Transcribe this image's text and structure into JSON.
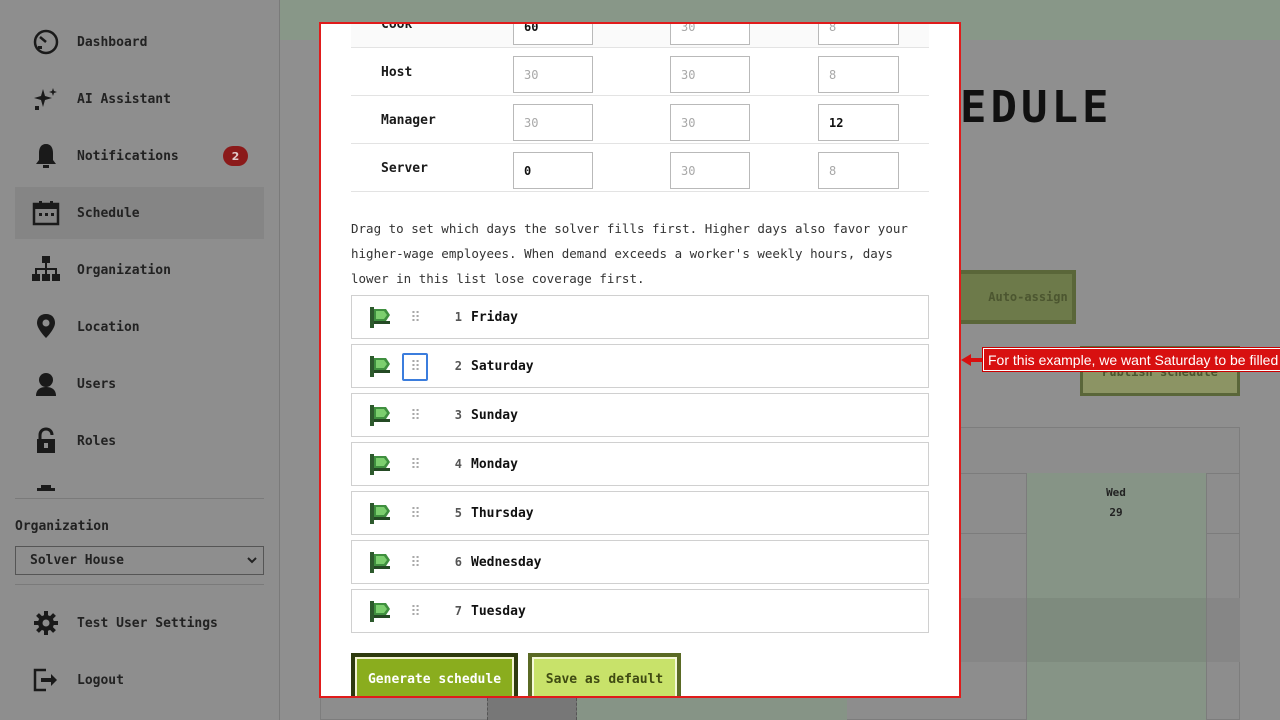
{
  "sidebar": {
    "items": [
      {
        "label": "Dashboard",
        "icon": "dashboard-icon"
      },
      {
        "label": "AI Assistant",
        "icon": "sparkle-icon"
      },
      {
        "label": "Notifications",
        "icon": "bell-icon",
        "badge": "2"
      },
      {
        "label": "Schedule",
        "icon": "calendar-icon",
        "active": true
      },
      {
        "label": "Organization",
        "icon": "org-chart-icon"
      },
      {
        "label": "Location",
        "icon": "map-pin-icon"
      },
      {
        "label": "Users",
        "icon": "user-icon"
      },
      {
        "label": "Roles",
        "icon": "lock-icon"
      }
    ],
    "organization_label": "Organization",
    "organization_value": "Solver House",
    "footer": [
      {
        "label": "Test User Settings",
        "icon": "gear-icon"
      },
      {
        "label": "Logout",
        "icon": "logout-icon"
      }
    ]
  },
  "background": {
    "page_title": "EDULE",
    "auto_assign_label": "Auto-assign",
    "publish_label": "Publish schedule",
    "calendar_day": "Wed",
    "calendar_date": "29"
  },
  "modal": {
    "demand_rows": [
      {
        "role": "Cook",
        "col1": "60",
        "col1_placeholder": "30",
        "col2": "",
        "col2_placeholder": "30",
        "col3": "",
        "col3_placeholder": "8"
      },
      {
        "role": "Host",
        "col1": "",
        "col1_placeholder": "30",
        "col2": "",
        "col2_placeholder": "30",
        "col3": "",
        "col3_placeholder": "8"
      },
      {
        "role": "Manager",
        "col1": "",
        "col1_placeholder": "30",
        "col2": "",
        "col2_placeholder": "30",
        "col3": "12",
        "col3_placeholder": "8"
      },
      {
        "role": "Server",
        "col1": "0",
        "col1_placeholder": "30",
        "col2": "",
        "col2_placeholder": "30",
        "col3": "",
        "col3_placeholder": "8"
      }
    ],
    "help_text": "Drag to set which days the solver fills first. Higher days also favor your higher-wage employees. When demand exceeds a worker's weekly hours, days lower in this list lose coverage first.",
    "priority_days": [
      {
        "rank": "1",
        "day": "Friday"
      },
      {
        "rank": "2",
        "day": "Saturday"
      },
      {
        "rank": "3",
        "day": "Sunday"
      },
      {
        "rank": "4",
        "day": "Monday"
      },
      {
        "rank": "5",
        "day": "Thursday"
      },
      {
        "rank": "6",
        "day": "Wednesday"
      },
      {
        "rank": "7",
        "day": "Tuesday"
      }
    ],
    "generate_label": "Generate schedule",
    "save_default_label": "Save as default"
  },
  "annotation": {
    "text": "For this example, we want Saturday to be filled"
  },
  "colors": {
    "accent_green": "#8aad1e",
    "annotation_red": "#d81010",
    "focus_blue": "#3b7ddd"
  }
}
